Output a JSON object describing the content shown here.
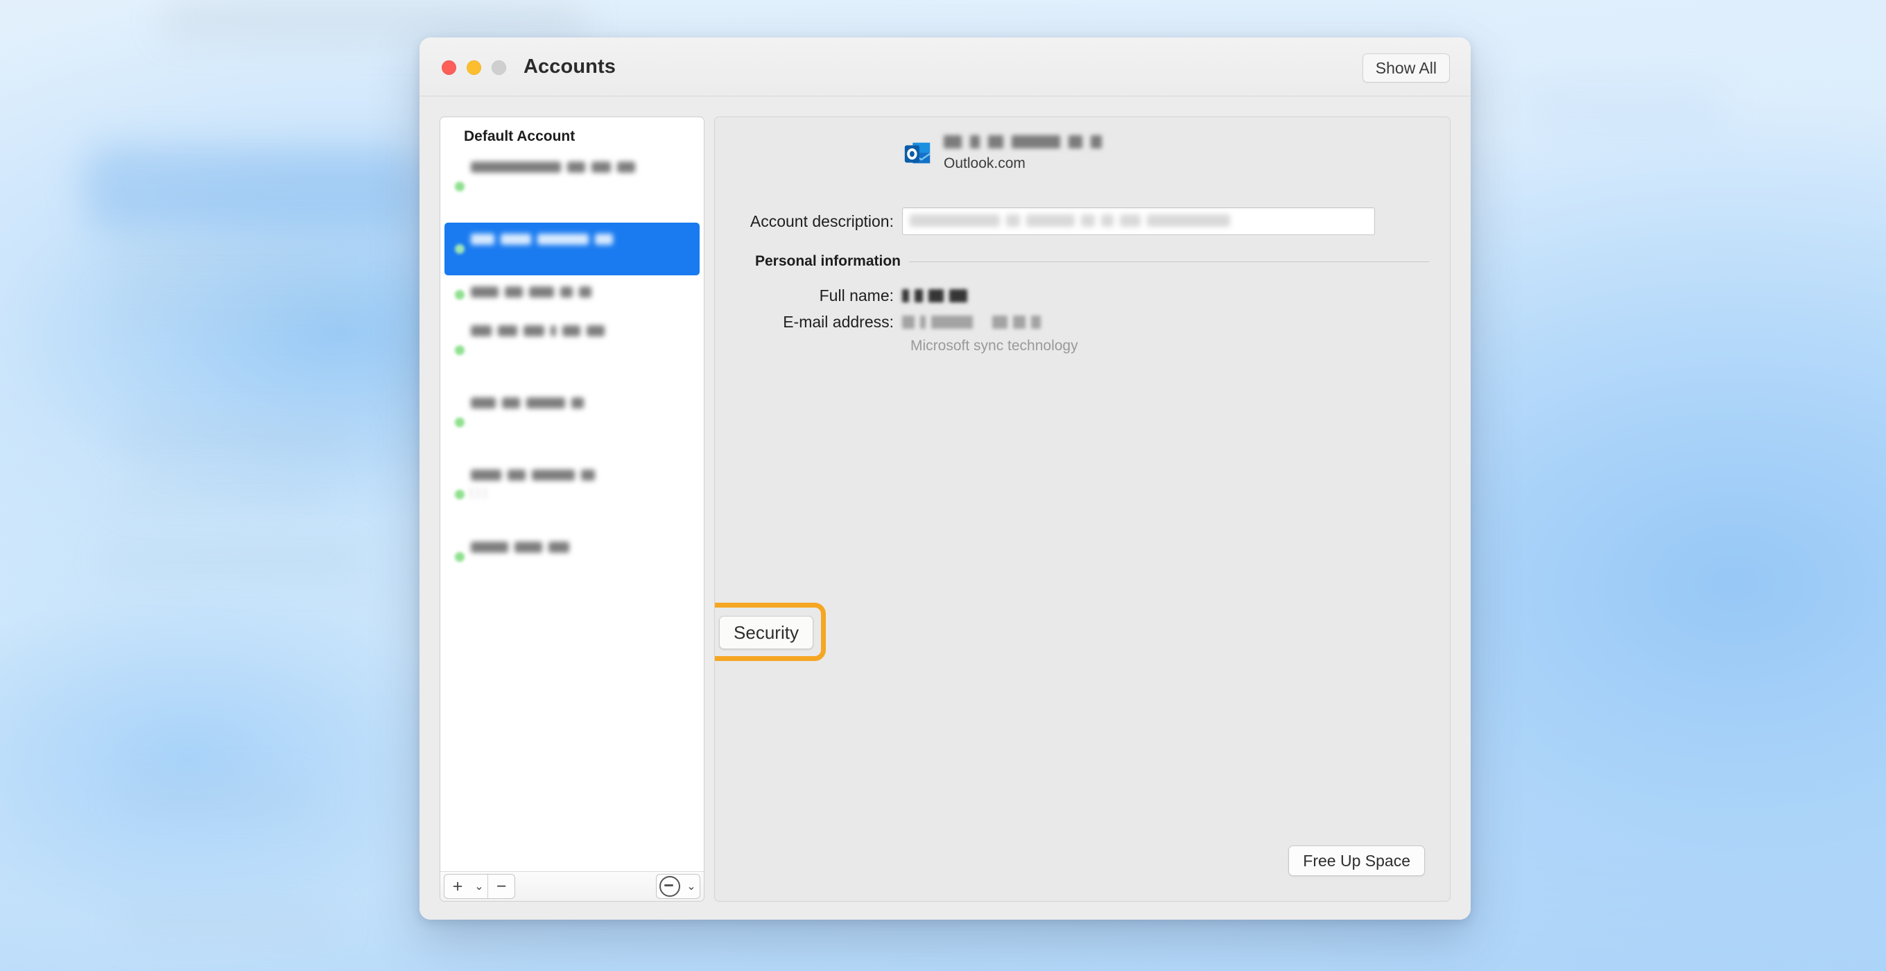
{
  "window": {
    "title": "Accounts",
    "traffic_lights": [
      "close-button",
      "minimize-button",
      "zoom-button"
    ],
    "show_all_label": "Show All"
  },
  "sidebar": {
    "header": "Default Account",
    "accounts": [
      {
        "status": "green",
        "line1_tokens": [
          130,
          26,
          28,
          26
        ],
        "line2_tokens": [
          44,
          120,
          0,
          26
        ],
        "line3_tokens": [
          14,
          10,
          24,
          26
        ],
        "selected": false
      },
      {
        "status": "green",
        "line1_tokens": [
          34,
          44,
          74,
          26
        ],
        "line2_tokens": [
          22,
          14,
          58,
          8
        ],
        "line3_tokens": [],
        "selected": true
      },
      {
        "status": "green",
        "line1_tokens": [
          40,
          26,
          36,
          18,
          18
        ],
        "line2_tokens": [],
        "line3_tokens": [],
        "selected": false
      },
      {
        "status": "green",
        "line1_tokens": [
          30,
          28,
          30,
          8,
          26,
          26
        ],
        "line2_tokens": [
          36,
          26,
          28,
          22
        ],
        "line3_tokens": [
          28,
          12,
          60,
          22
        ],
        "selected": false
      },
      {
        "status": "green",
        "line1_tokens": [
          36,
          26,
          56,
          18
        ],
        "line2_tokens": [
          44,
          26,
          26,
          22
        ],
        "line3_tokens": [
          12,
          38,
          44,
          16
        ],
        "selected": false
      },
      {
        "status": "green",
        "line1_tokens": [
          44,
          26,
          62,
          20
        ],
        "line2_tokens": [
          18,
          64,
          18
        ],
        "line3_tokens": [
          26,
          14,
          64,
          18
        ],
        "selected": false
      },
      {
        "status": "green",
        "line1_tokens": [
          54,
          40,
          30
        ],
        "line2_tokens": [
          40,
          36,
          16,
          34
        ],
        "line3_tokens": [],
        "selected": false
      }
    ],
    "toolbar": {
      "add_label": "+",
      "add_menu_label": "⌄",
      "remove_label": "−",
      "action_label": "action-menu",
      "action_menu_label": "⌄"
    }
  },
  "content": {
    "account_name_tokens": [
      26,
      14,
      22,
      70,
      20,
      16
    ],
    "provider": "Outlook.com",
    "account_description_label": "Account description:",
    "account_description_tokens": [
      130,
      20,
      70,
      20,
      18,
      30,
      120
    ],
    "personal_information_label": "Personal information",
    "full_name_label": "Full name:",
    "full_name_tokens": [
      10,
      12,
      22,
      26
    ],
    "email_label": "E-mail address:",
    "email_tokens": [
      18,
      8,
      60,
      0,
      22,
      18,
      14
    ],
    "sync_note": "Microsoft sync technology",
    "security_label": "Security",
    "free_up_space_label": "Free Up Space"
  },
  "colors": {
    "accent_blue": "#1a7bf0",
    "highlight_orange": "#f5a623",
    "status_green": "#8fe08f",
    "outlook_blue": "#0f6cbd",
    "window_chrome": "#ececec",
    "panel_gray": "#e9e9e9"
  }
}
